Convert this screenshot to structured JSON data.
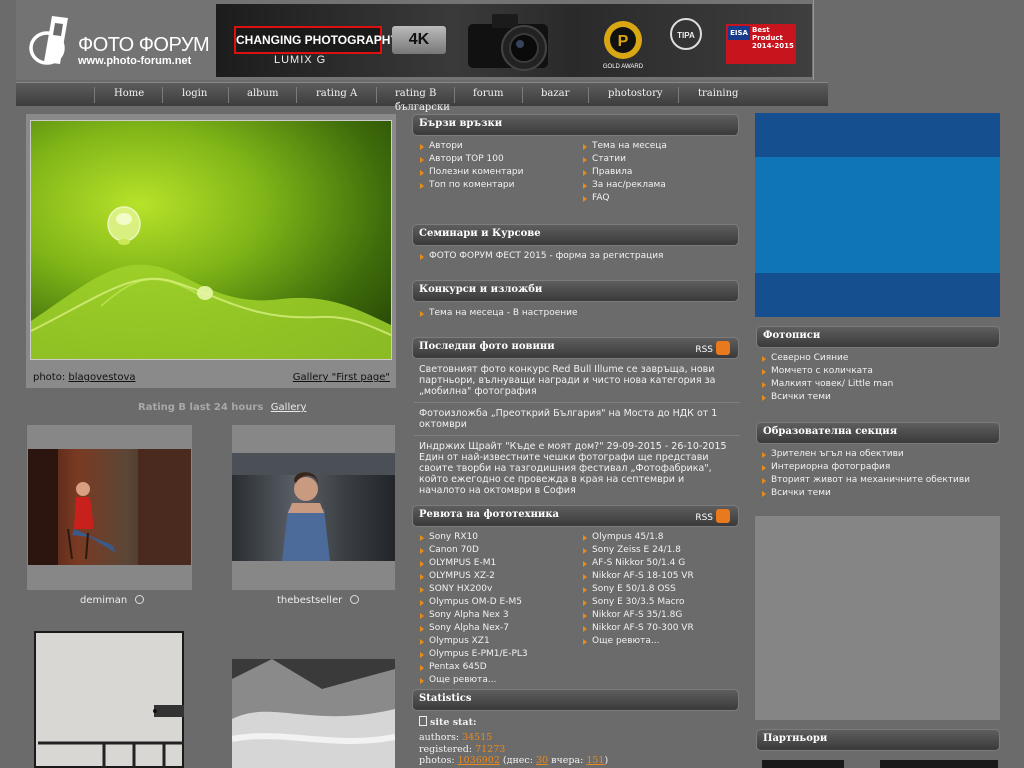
{
  "logo": {
    "title": "ФОТО ФОРУМ",
    "url": "www.photo-forum.net"
  },
  "banner": {
    "tag": "CHANGING PHOTOGRAPHY",
    "brand": "LUMIX G",
    "badge": "4K",
    "award_gold": "GOLD AWARD",
    "award_tipa": "TIPA",
    "eisa_left": "EISA",
    "eisa_right": "Best Product 2014-2015"
  },
  "nav": [
    "Home",
    "login",
    "album",
    "rating A",
    "rating B",
    "forum",
    "bazar",
    "photostory",
    "training"
  ],
  "nav_sub": "български",
  "featured": {
    "photo_label": "photo:",
    "author": "blagovestova",
    "gallery_link": "Gallery \"First page\""
  },
  "rating": {
    "label": "Rating B last 24 hours",
    "gallery": "Gallery"
  },
  "thumbs": [
    {
      "name": "demiman"
    },
    {
      "name": "thebestseller"
    }
  ],
  "quick_links": {
    "title": "Бързи връзки",
    "left": [
      "Автори",
      "Автори TOP 100",
      "Полезни коментари",
      "Топ по коментари"
    ],
    "right": [
      "Тема на месеца",
      "Статии",
      "Правила",
      "За нас/реклама",
      "FAQ"
    ]
  },
  "seminars": {
    "title": "Семинари и Курсове",
    "items": [
      "ФОТО ФОРУМ ФЕСТ 2015 - форма за регистрация"
    ]
  },
  "contests": {
    "title": "Конкурси и изложби",
    "items": [
      "Тема на месеца - В настроение"
    ]
  },
  "news": {
    "title": "Последни фото новини",
    "rss": "RSS",
    "items": [
      "Световният фото конкурс Red Bull Illume се завръща, нови партньори, вълнуващи награди и чисто нова категория за „мобилна\" фотография",
      "Фотоизложба „Преоткрий България\" на Моста до НДК от 1 октомври",
      "Индржих Щрайт \"Къде е моят дом?\" 29-09-2015 - 26-10-2015 Един от най-известните чешки фотографи ще представи своите творби на тазгодишния фестивал „Фотофабрика\", който ежегодно се провежда в края на септември и началото на октомври в София"
    ]
  },
  "reviews": {
    "title": "Ревюта на фототехника",
    "rss": "RSS",
    "left": [
      "Sony RX10",
      "Canon 70D",
      "OLYMPUS E-M1",
      "OLYMPUS XZ-2",
      "SONY HX200v",
      "Olympus OM-D E-M5",
      "Sony Alpha Nex 3",
      "Sony Alpha Nex-7",
      "Olympus XZ1",
      "Olympus E-PM1/E-PL3",
      "Pentax 645D",
      "Още ревюта..."
    ],
    "right": [
      "Olympus 45/1.8",
      "Sony Zeiss E 24/1.8",
      "AF-S Nikkor 50/1.4 G",
      "Nikkor AF-S 18-105 VR",
      "Sony E 50/1.8 OSS",
      "Sony E 30/3.5 Macro",
      "Nikkor AF-S 35/1.8G",
      "Nikkor AF-S 70-300 VR",
      "Още ревюта..."
    ]
  },
  "statistics": {
    "title": "Statistics",
    "site_stat": "site stat:",
    "authors_label": "authors:",
    "authors": "34515",
    "registered_label": "registered:",
    "registered": "71273",
    "photos_label": "photos:",
    "photos": "1036902",
    "today_label": "(днес:",
    "today": "30",
    "yesterday_label": "вчера:",
    "yesterday": "151",
    "close": ")"
  },
  "fotopisi": {
    "title": "Фотописи",
    "items": [
      "Северно Сияние",
      "Момчето с количката",
      "Малкият човек/ Little man",
      "Всички теми"
    ]
  },
  "education": {
    "title": "Образователна секция",
    "items": [
      "Зрителен ъгъл на обективи",
      "Интериорна фотография",
      "Вторият живот на механичните обективи",
      "Всички теми"
    ]
  },
  "partners": {
    "title": "Партньори"
  },
  "colors": {
    "accent": "#e8891f",
    "background": "#6b6b6b",
    "banner_blue": "#0f75b6"
  }
}
